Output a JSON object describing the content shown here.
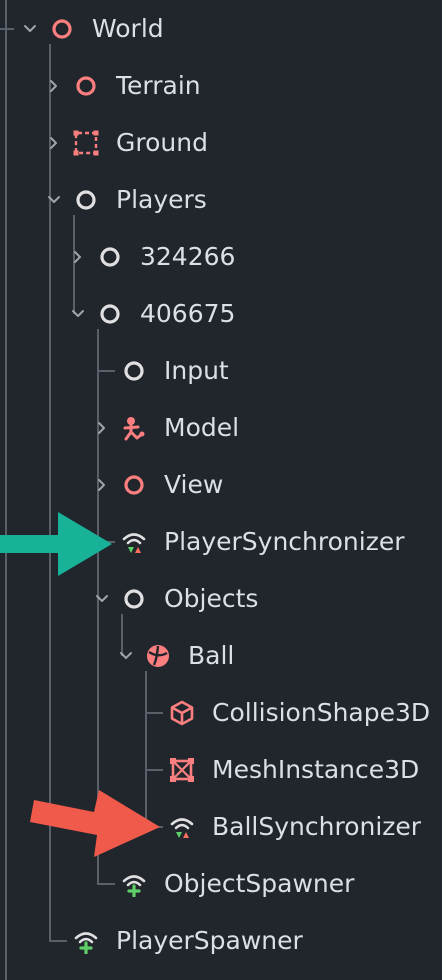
{
  "tree": {
    "nodes": [
      {
        "label": "World",
        "icon": "node3d-icon",
        "color": "#fc7f7f"
      },
      {
        "label": "Terrain",
        "icon": "node3d-icon",
        "color": "#fc7f7f"
      },
      {
        "label": "Ground",
        "icon": "dashed-rect-icon",
        "color": "#fc7f7f"
      },
      {
        "label": "Players",
        "icon": "node-icon",
        "color": "#e0e0e0"
      },
      {
        "label": "324266",
        "icon": "node-icon",
        "color": "#e0e0e0"
      },
      {
        "label": "406675",
        "icon": "node-icon",
        "color": "#e0e0e0"
      },
      {
        "label": "Input",
        "icon": "node-icon",
        "color": "#e0e0e0"
      },
      {
        "label": "Model",
        "icon": "skeleton-icon",
        "color": "#fc7f7f"
      },
      {
        "label": "View",
        "icon": "node3d-icon",
        "color": "#fc7f7f"
      },
      {
        "label": "PlayerSynchronizer",
        "icon": "synchronizer-icon"
      },
      {
        "label": "Objects",
        "icon": "node-icon",
        "color": "#e0e0e0"
      },
      {
        "label": "Ball",
        "icon": "rigidbody-icon",
        "color": "#fc7f7f"
      },
      {
        "label": "CollisionShape3D",
        "icon": "collision-shape-icon",
        "color": "#fc7f7f"
      },
      {
        "label": "MeshInstance3D",
        "icon": "mesh-instance-icon",
        "color": "#fc7f7f"
      },
      {
        "label": "BallSynchronizer",
        "icon": "synchronizer-icon"
      },
      {
        "label": "ObjectSpawner",
        "icon": "spawner-icon"
      },
      {
        "label": "PlayerSpawner",
        "icon": "spawner-icon"
      }
    ]
  },
  "annotations": {
    "teal_arrow_color": "#17b297",
    "red_arrow_color": "#f05a4a"
  }
}
